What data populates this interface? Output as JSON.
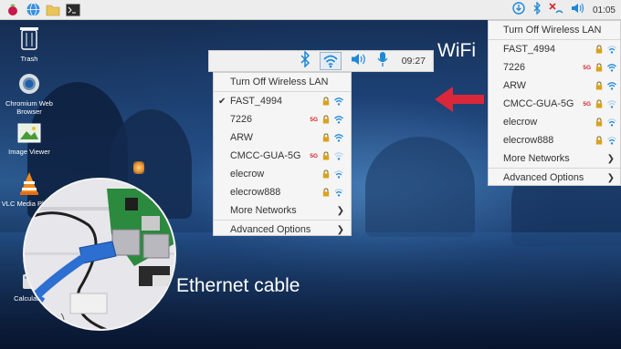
{
  "taskbar": {
    "time": "01:05",
    "icons": [
      "raspberry-icon",
      "globe-icon",
      "folder-icon",
      "terminal-icon",
      "update-icon",
      "bluetooth-icon",
      "network-disconnected-icon",
      "volume-icon"
    ]
  },
  "desktop_icons": [
    {
      "label": "Trash",
      "icon": "trash-icon"
    },
    {
      "label": "Chromium Web Browser",
      "icon": "chromium-icon"
    },
    {
      "label": "Image Viewer",
      "icon": "image-viewer-icon"
    },
    {
      "label": "VLC Media Player",
      "icon": "vlc-icon"
    },
    {
      "label": "Calculator",
      "icon": "calculator-icon"
    }
  ],
  "panel": {
    "clock": "09:27",
    "icons": [
      "bluetooth-icon",
      "wifi-icon",
      "volume-icon",
      "microphone-icon"
    ]
  },
  "menu_left": {
    "turn_off": "Turn Off Wireless LAN",
    "networks": [
      {
        "ssid": "FAST_4994",
        "connected": true,
        "five_g": false,
        "signal": "high"
      },
      {
        "ssid": "7226",
        "connected": false,
        "five_g": true,
        "signal": "high"
      },
      {
        "ssid": "ARW",
        "connected": false,
        "five_g": false,
        "signal": "high"
      },
      {
        "ssid": "CMCC-GUA-5G",
        "connected": false,
        "five_g": true,
        "signal": "low"
      },
      {
        "ssid": "elecrow",
        "connected": false,
        "five_g": false,
        "signal": "medium"
      },
      {
        "ssid": "elecrow888",
        "connected": false,
        "five_g": false,
        "signal": "medium"
      }
    ],
    "more": "More Networks",
    "advanced": "Advanced Options",
    "tag_5g": "5G"
  },
  "menu_right": {
    "turn_off": "Turn Off Wireless LAN",
    "networks": [
      {
        "ssid": "FAST_4994",
        "five_g": false,
        "signal": "medium"
      },
      {
        "ssid": "7226",
        "five_g": true,
        "signal": "high"
      },
      {
        "ssid": "ARW",
        "five_g": false,
        "signal": "high"
      },
      {
        "ssid": "CMCC-GUA-5G",
        "five_g": true,
        "signal": "low"
      },
      {
        "ssid": "elecrow",
        "five_g": false,
        "signal": "medium"
      },
      {
        "ssid": "elecrow888",
        "five_g": false,
        "signal": "medium"
      }
    ],
    "more": "More Networks",
    "advanced": "Advanced Options",
    "tag_5g": "5G"
  },
  "callouts": {
    "wifi": "WiFi",
    "ethernet": "Ethernet cable"
  },
  "colors": {
    "accent_blue": "#1e88d6",
    "lock_gold": "#d9a21b",
    "tag_red": "#d6262f",
    "arrow_red": "#d8283a",
    "cable_blue": "#2c6fd1"
  }
}
